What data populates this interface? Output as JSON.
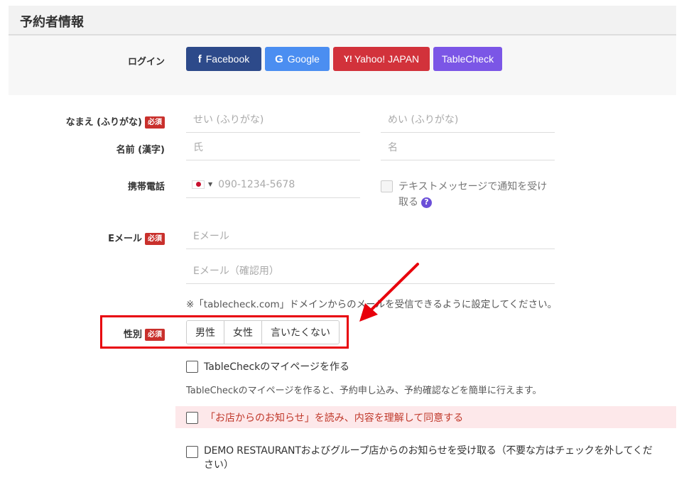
{
  "section": {
    "title": "予約者情報"
  },
  "login": {
    "label": "ログイン",
    "buttons": [
      {
        "label": "Facebook",
        "icon": "f",
        "color": "#2d4a8a"
      },
      {
        "label": "Google",
        "icon": "G",
        "color": "#4b8ef1"
      },
      {
        "label": "Yahoo! JAPAN",
        "icon": "Y!",
        "color": "#d2323b"
      },
      {
        "label": "TableCheck",
        "icon": "",
        "color": "#7b56e6"
      }
    ]
  },
  "required_badge": "必須",
  "name_kana": {
    "label": "なまえ (ふりがな)",
    "first_placeholder": "せい (ふりがな)",
    "last_placeholder": "めい (ふりがな)"
  },
  "name_kanji": {
    "label": "名前 (漢字)",
    "first_placeholder": "氏",
    "last_placeholder": "名"
  },
  "phone": {
    "label": "携帯電話",
    "placeholder": "090-1234-5678",
    "country_flag": "jp-flag-icon",
    "sms_label_line1": "テキストメッセージで通知を受け",
    "sms_label_line2": "取る",
    "help_icon": "?"
  },
  "email": {
    "label": "Eメール",
    "placeholder": "Eメール",
    "confirm_placeholder": "Eメール（確認用）",
    "note": "※「tablecheck.com」ドメインからのメールを受信できるように設定してください。"
  },
  "gender": {
    "label": "性別",
    "options": [
      "男性",
      "女性",
      "言いたくない"
    ]
  },
  "mypage": {
    "checkbox_label": "TableCheckのマイページを作る",
    "description": "TableCheckのマイページを作ると、予約申し込み、予約確認などを簡単に行えます。"
  },
  "consent": {
    "label": "「お店からのお知らせ」を読み、内容を理解して同意する"
  },
  "newsletter": {
    "line1": "DEMO RESTAURANTおよびグループ店からのお知らせを受け取る（不要な方はチェックを外してくだ",
    "line2": "さい）"
  },
  "colors": {
    "highlight": "#e8000b",
    "required": "#c9302c",
    "consent_text": "#c0392b",
    "consent_bg": "#fde8ea"
  }
}
